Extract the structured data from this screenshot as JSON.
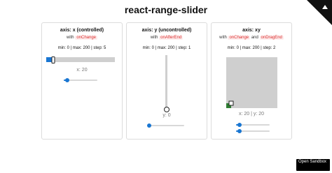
{
  "page": {
    "title": "react-range-slider"
  },
  "cards": [
    {
      "title": "axis: x (controlled)",
      "sub_prefix": "with",
      "handlers": [
        "onChange"
      ],
      "info": "min: 0 | max: 200 | step: 5",
      "readout": "x: 20",
      "value": 20,
      "min": 0,
      "max": 200,
      "mini_slider_fraction": 0.1
    },
    {
      "title": "axis: y (uncontrolled)",
      "sub_prefix": "with",
      "handlers": [
        "onAfterEnd"
      ],
      "info": "min: 0 | max: 200 | step: 1",
      "readout": "y: 0",
      "value": 0,
      "min": 0,
      "max": 200,
      "mini_slider_fraction": 0.0
    },
    {
      "title": "axis: xy",
      "sub_prefix": "with",
      "handlers": [
        "onChange",
        "onDragEnd"
      ],
      "sub_joiner": "and",
      "info": "min: 0 | max: 200 | step: 2",
      "readout": "x: 20 | y: 20",
      "x": 20,
      "y": 20,
      "min": 0,
      "max": 200,
      "mini_slider_fractions": [
        0.1,
        0.1
      ]
    }
  ],
  "sandbox_button": {
    "label": "Open Sandbox"
  },
  "corner_link": {
    "icon": "github-corner-icon"
  },
  "colors": {
    "accent": "#1976d2",
    "xy_fill": "#2e7d32",
    "tag_bg": "#fdecec",
    "tag_text": "#d33333"
  }
}
